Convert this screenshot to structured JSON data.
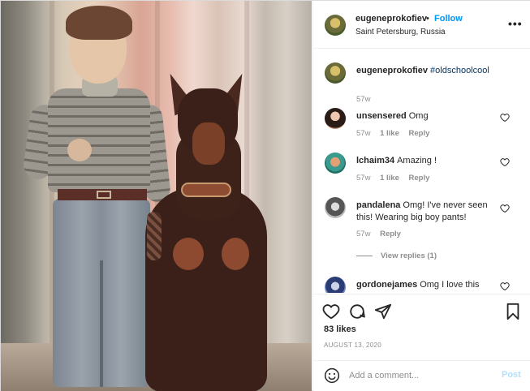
{
  "post": {
    "username": "eugeneprokofiev",
    "follow_label": "Follow",
    "separator": "•",
    "location": "Saint Petersburg, Russia",
    "more": "•••"
  },
  "comments": [
    {
      "username": "eugeneprokofiev",
      "text": "",
      "hashtag": "#oldschoolcool",
      "age": "57w",
      "likes": "",
      "reply": ""
    },
    {
      "username": "unsensered",
      "text": "Omg",
      "age": "57w",
      "likes": "1 like",
      "reply": "Reply"
    },
    {
      "username": "lchaim34",
      "text": "Amazing !",
      "age": "57w",
      "likes": "1 like",
      "reply": "Reply"
    },
    {
      "username": "pandalena",
      "text": "Omg! I've never seen this! Wearing big boy pants!",
      "age": "57w",
      "likes": "",
      "reply": "Reply",
      "view_replies": "View replies (1)"
    },
    {
      "username": "gordonejames",
      "text": "Omg I love this"
    }
  ],
  "actions": {
    "likes_count": "83 likes",
    "date": "AUGUST 13, 2020"
  },
  "add_comment": {
    "placeholder": "Add a comment...",
    "post_label": "Post"
  },
  "icons": {
    "like": "heart-icon",
    "comment": "comment-icon",
    "share": "send-icon",
    "save": "bookmark-icon",
    "emoji": "emoji-icon",
    "more": "more-options-icon"
  },
  "colors": {
    "follow": "#0095f6",
    "hashtag": "#00376b",
    "muted": "#8e8e8e",
    "post_disabled": "#b2dffc"
  }
}
